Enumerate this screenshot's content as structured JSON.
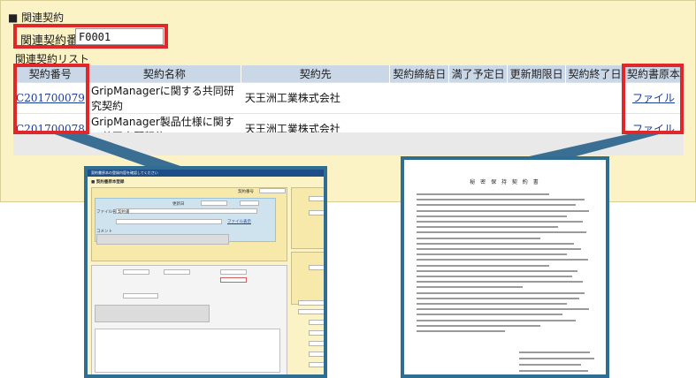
{
  "section": {
    "title": "■ 関連契約"
  },
  "contract_number_field": {
    "label": "関連契約番号",
    "value": "F0001"
  },
  "list": {
    "label": "関連契約リスト",
    "columns": [
      "契約番号",
      "契約名称",
      "契約先",
      "契約締結日",
      "満了予定日",
      "更新期限日",
      "契約終了日",
      "契約書原本"
    ],
    "rows": [
      {
        "number": "C201700079",
        "name": "GripManagerに関する共同研究契約",
        "party": "天王洲工業株式会社",
        "signed": "",
        "expiry": "",
        "renewal": "",
        "end": "",
        "file": "ファイル"
      },
      {
        "number": "C201700078",
        "name": "GripManager製品仕様に関する共同出願契約",
        "party": "天王洲工業株式会社",
        "signed": "",
        "expiry": "",
        "renewal": "",
        "end": "",
        "file": "ファイル"
      }
    ]
  },
  "colors": {
    "panel_bg": "#fbf3c5",
    "header_bg": "#c9d7e7",
    "highlight": "#e0282a",
    "callout": "#2f6d91",
    "link": "#1a3d9b"
  },
  "left_preview": {
    "header": "契約書原本の登録内容を確認してください",
    "sub_title": "■ 契約書原本登録",
    "number_label": "契約番号",
    "date_label": "更新日",
    "file_name_label": "ファイル名",
    "file_name_value": "契約書",
    "comment_label": "コメント",
    "file_link": "ファイル表示"
  },
  "right_preview": {
    "title": "秘 密 保 持 契 約 書"
  }
}
